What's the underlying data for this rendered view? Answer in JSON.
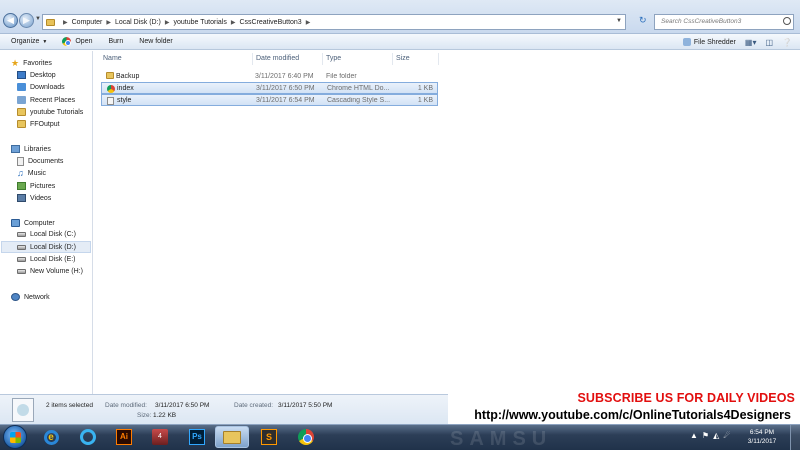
{
  "address": {
    "breadcrumbs": [
      "Computer",
      "Local Disk (D:)",
      "youtube Tutorials",
      "CssCreativeButton3"
    ],
    "search_placeholder": "Search CssCreativeButton3"
  },
  "toolbar": {
    "organize": "Organize",
    "open": "Open",
    "burn": "Burn",
    "new_folder": "New folder",
    "file_shredder": "File Shredder"
  },
  "nav": {
    "favorites": "Favorites",
    "desktop": "Desktop",
    "downloads": "Downloads",
    "recent": "Recent Places",
    "youtube": "youtube Tutorials",
    "ffoutput": "FFOutput",
    "libraries": "Libraries",
    "documents": "Documents",
    "music": "Music",
    "pictures": "Pictures",
    "videos": "Videos",
    "computer": "Computer",
    "disk_c": "Local Disk (C:)",
    "disk_d": "Local Disk (D:)",
    "disk_e": "Local Disk (E:)",
    "disk_h": "New Volume (H:)",
    "network": "Network"
  },
  "columns": {
    "name": "Name",
    "date": "Date modified",
    "type": "Type",
    "size": "Size"
  },
  "files": [
    {
      "name": "Backup",
      "date": "3/11/2017 6:40 PM",
      "type": "File folder",
      "size": "",
      "icon": "folder-icon",
      "selected": false
    },
    {
      "name": "index",
      "date": "3/11/2017 6:50 PM",
      "type": "Chrome HTML Do...",
      "size": "1 KB",
      "icon": "chrome-icon",
      "selected": true
    },
    {
      "name": "style",
      "date": "3/11/2017 6:54 PM",
      "type": "Cascading Style S...",
      "size": "1 KB",
      "icon": "css-file-icon",
      "selected": true
    }
  ],
  "details": {
    "count": "2 items selected",
    "modified_label": "Date modified:",
    "modified_value": "3/11/2017 6:50 PM",
    "created_label": "Date created:",
    "created_value": "3/11/2017 5:50 PM",
    "size_label": "Size:",
    "size_value": "1.22 KB"
  },
  "overlay": {
    "subscribe": "SUBSCRIBE US FOR DAILY VIDEOS",
    "url": "http://www.youtube.com/c/OnlineTutorials4Designers"
  },
  "taskbar": {
    "app4_badge": "4",
    "ai_label": "Ai",
    "ps_label": "Ps",
    "sublime_label": "S",
    "clock_time": "6:54 PM",
    "clock_date": "3/11/2017",
    "watermark": "SAMSU"
  }
}
